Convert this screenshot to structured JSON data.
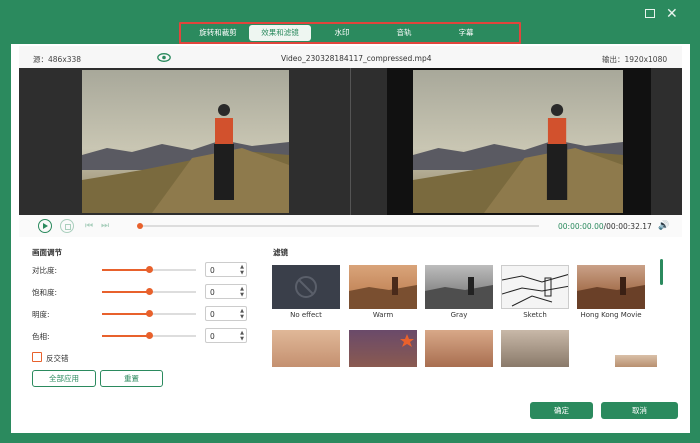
{
  "window": {
    "maximize_icon": "maximize-icon",
    "close_icon": "close-icon",
    "close_glyph": "✕"
  },
  "tabs": [
    {
      "label": "旋转和裁剪",
      "active": false
    },
    {
      "label": "效果和滤镜",
      "active": true
    },
    {
      "label": "水印",
      "active": false
    },
    {
      "label": "音轨",
      "active": false
    },
    {
      "label": "字幕",
      "active": false
    }
  ],
  "info_bar": {
    "source": "源：486x338",
    "filename": "Video_230328184117_compressed.mp4",
    "output": "输出：1920x1080"
  },
  "player": {
    "current_time": "00:00:00.00",
    "total_time": "/00:00:32.17",
    "seek_progress": 0.0
  },
  "adjust": {
    "title": "画面调节",
    "rows": [
      {
        "label": "对比度:",
        "value": "0",
        "level": 0.5
      },
      {
        "label": "饱和度:",
        "value": "0",
        "level": 0.5
      },
      {
        "label": "明度:",
        "value": "0",
        "level": 0.5
      },
      {
        "label": "色相:",
        "value": "0",
        "level": 0.5
      }
    ],
    "deinterlace_label": "反交错",
    "apply_all_label": "全部应用",
    "reset_label": "重置"
  },
  "filters": {
    "title": "滤镜",
    "items": [
      {
        "label": "No effect"
      },
      {
        "label": "Warm"
      },
      {
        "label": "Gray"
      },
      {
        "label": "Sketch"
      },
      {
        "label": "Hong Kong Movie"
      }
    ]
  },
  "footer": {
    "ok_label": "确定",
    "cancel_label": "取消"
  },
  "colors": {
    "accent": "#2b8a5e",
    "slider": "#e8612c",
    "highlight_border": "#e0453c"
  }
}
